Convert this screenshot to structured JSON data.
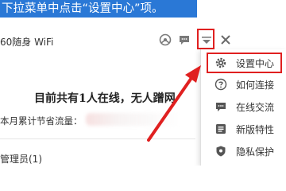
{
  "banner": {
    "text": "下拉菜单中点击“设置中心”项。"
  },
  "window": {
    "app_title": "60随身 WiFi",
    "heading": "目前共有1人在线，无人蹭网",
    "traffic_label": "本月累计节省流量：",
    "admin_label": "管理员(1)"
  },
  "title_icons": [
    "share-icon",
    "chat-icon",
    "menu-toggle-icon",
    "close-icon"
  ],
  "dropdown": {
    "items": [
      {
        "icon": "gear-icon",
        "label": "设置中心"
      },
      {
        "icon": "help-icon",
        "label": "如何连接"
      },
      {
        "icon": "chat-bubble-icon",
        "label": "在线交流"
      },
      {
        "icon": "features-icon",
        "label": "新版特性"
      },
      {
        "icon": "shield-icon",
        "label": "隐私保护"
      }
    ]
  },
  "colors": {
    "banner_bg": "#2a78d6",
    "annotation_red": "#e02020",
    "icon_gray": "#7a7a7a"
  }
}
